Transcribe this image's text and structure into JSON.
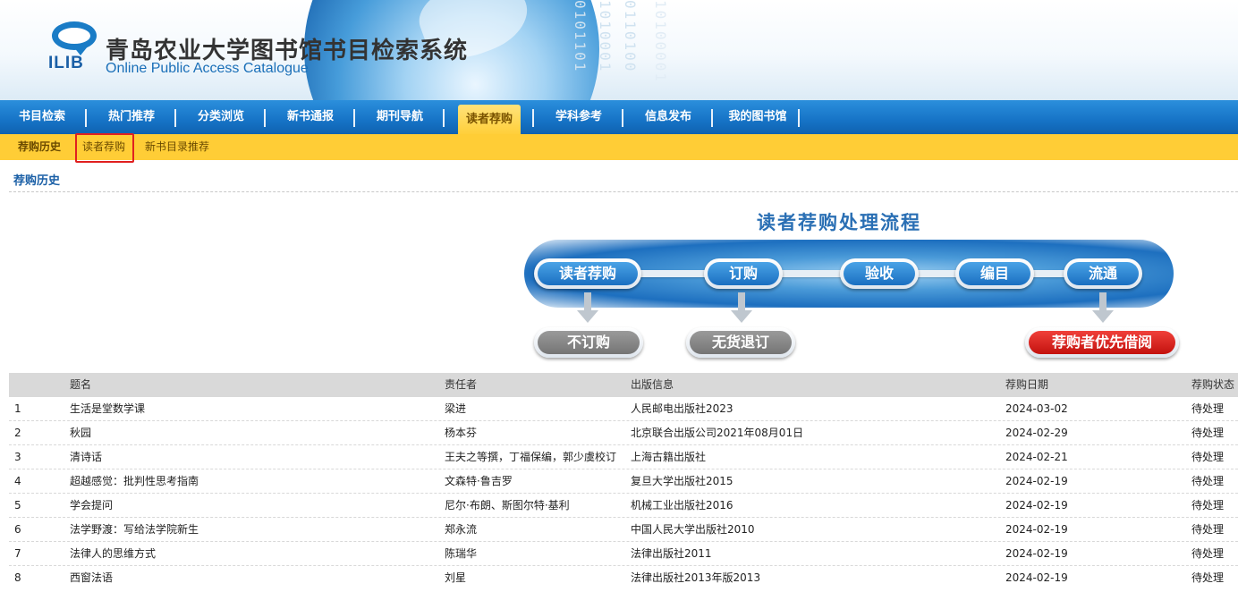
{
  "header": {
    "logo_text": "ILIB",
    "title": "青岛农业大学图书馆书目检索系统",
    "subtitle": "Online Public Access Catalogue",
    "binary_cols": [
      "0101101",
      "1010001",
      "0110100",
      "10100001"
    ]
  },
  "nav": {
    "items": [
      {
        "label": "书目检索"
      },
      {
        "label": "热门推荐"
      },
      {
        "label": "分类浏览"
      },
      {
        "label": "新书通报"
      },
      {
        "label": "期刊导航"
      },
      {
        "label": "读者荐购",
        "active": true
      },
      {
        "label": "学科参考"
      },
      {
        "label": "信息发布"
      },
      {
        "label": "我的图书馆"
      }
    ]
  },
  "subnav": {
    "items": [
      {
        "label": "荐购历史"
      },
      {
        "label": "读者荐购"
      },
      {
        "label": "新书目录推荐"
      }
    ]
  },
  "section": {
    "title": "荐购历史"
  },
  "flow": {
    "title": "读者荐购处理流程",
    "steps": [
      "读者荐购",
      "订购",
      "验收",
      "编目",
      "流通"
    ],
    "outcomes": [
      "不订购",
      "无货退订",
      "荐购者优先借阅"
    ]
  },
  "table": {
    "headers": [
      "题名",
      "责任者",
      "出版信息",
      "荐购日期",
      "荐购状态"
    ],
    "rows": [
      {
        "no": "1",
        "title": "生活是堂数学课",
        "author": "梁进",
        "pub": "人民邮电出版社2023",
        "date": "2024-03-02",
        "status": "待处理"
      },
      {
        "no": "2",
        "title": "秋园",
        "author": "杨本芬",
        "pub": "北京联合出版公司2021年08月01日",
        "date": "2024-02-29",
        "status": "待处理"
      },
      {
        "no": "3",
        "title": "清诗话",
        "author": "王夫之等撰，丁福保编，郭少虞校订",
        "pub": "上海古籍出版社",
        "date": "2024-02-21",
        "status": "待处理"
      },
      {
        "no": "4",
        "title": "超越感觉：批判性思考指南",
        "author": "文森特·鲁吉罗",
        "pub": "复旦大学出版社2015",
        "date": "2024-02-19",
        "status": "待处理"
      },
      {
        "no": "5",
        "title": "学会提问",
        "author": "尼尔·布朗、斯图尔特·基利",
        "pub": "机械工业出版社2016",
        "date": "2024-02-19",
        "status": "待处理"
      },
      {
        "no": "6",
        "title": "法学野渡：写给法学院新生",
        "author": "郑永流",
        "pub": "中国人民大学出版社2010",
        "date": "2024-02-19",
        "status": "待处理"
      },
      {
        "no": "7",
        "title": "法律人的思维方式",
        "author": "陈瑞华",
        "pub": "法律出版社2011",
        "date": "2024-02-19",
        "status": "待处理"
      },
      {
        "no": "8",
        "title": "西窗法语",
        "author": "刘星",
        "pub": "法律出版社2013年版2013",
        "date": "2024-02-19",
        "status": "待处理"
      }
    ]
  },
  "colors": {
    "nav_blue": "#1673c6",
    "sub_yellow": "#ffcd36",
    "accent_blue": "#1a5fa6",
    "highlight_red": "#e02020"
  }
}
